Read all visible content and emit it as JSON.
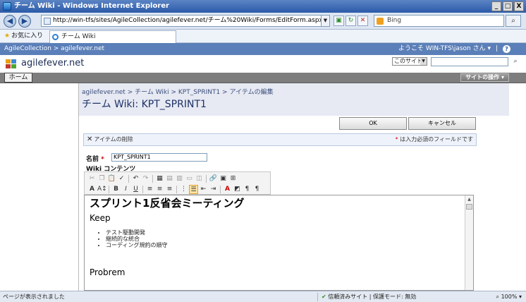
{
  "window": {
    "title": "チーム Wiki - Windows Internet Explorer",
    "controls": {
      "minimize": "_",
      "maximize": "□",
      "close": "X"
    }
  },
  "browser": {
    "address": "http://win-tfs/sites/AgileCollection/agilefever.net/チーム%20Wiki/Forms/EditForm.aspx?ID=8",
    "search_text": "Bing",
    "favorites_label": "お気に入り",
    "tab_title": "チーム Wiki"
  },
  "sharepoint": {
    "top_crumb": "AgileCollection > agilefever.net",
    "welcome": "ようこそ WIN-TFS\\jason さん ▾",
    "help_icon": "?",
    "site_name": "agilefever.net",
    "search_scope": "このサイト",
    "home_tab": "ホーム",
    "site_actions": "サイトの操作 ▾",
    "breadcrumb": "agilefever.net > チーム Wiki > KPT_SPRINT1 > アイテムの編集",
    "page_title": "チーム Wiki: KPT_SPRINT1"
  },
  "form": {
    "ok_label": "OK",
    "cancel_label": "キャンセル",
    "delete_label": "アイテムの削除",
    "required_note": "は入力必須のフィールドです",
    "name_label": "名前",
    "name_value": "KPT_SPRINT1",
    "wiki_label": "Wiki コンテンツ"
  },
  "document": {
    "heading": "スプリント1反省会ミーティング",
    "keep_heading": "Keep",
    "keep_items": [
      "テスト駆動開発",
      "継続的な統合",
      "コーディング規約の順守"
    ],
    "problem_heading": "Probrem"
  },
  "statusbar": {
    "message": "ページが表示されました",
    "zone": "信頼済みサイト | 保護モード: 無効",
    "zoom": "100%"
  }
}
